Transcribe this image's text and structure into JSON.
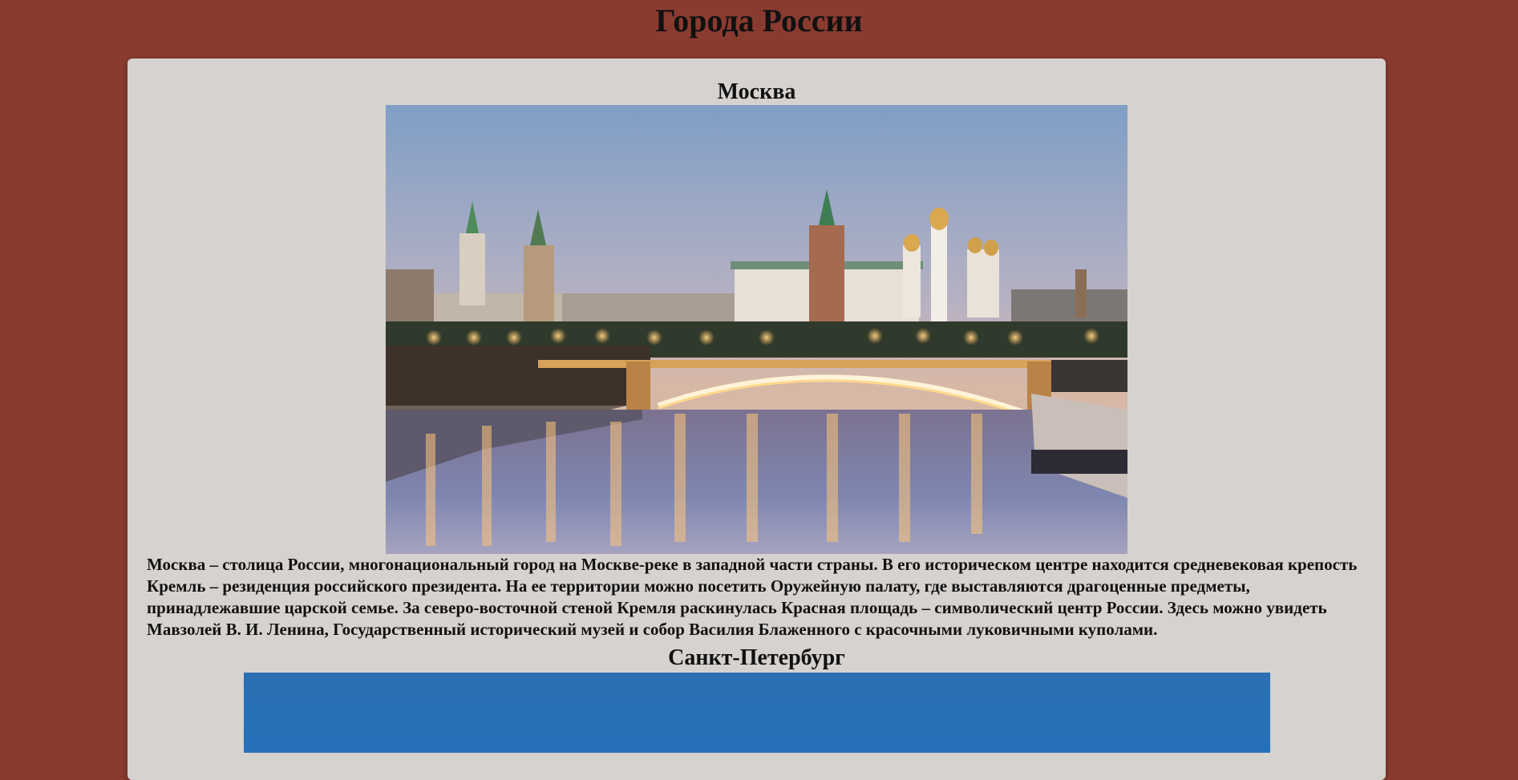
{
  "page": {
    "title": "Города России"
  },
  "cities": [
    {
      "name": "Москва",
      "image_icon": "moscow-kremlin-photo",
      "description": "Москва – столица России, многонациональный город на Москве-реке в западной части страны. В его историческом центре находится средневековая крепость Кремль – резиденция российского президента. На ее территории можно посетить Оружейную палату, где выставляются драгоценные предметы, принадлежавшие царской семье. За северо-восточной стеной Кремля раскинулась Красная площадь – символический центр России. Здесь можно увидеть Мавзолей В. И. Ленина, Государственный исторический музей и собор Василия Блаженного с красочными луковичными куполами."
    },
    {
      "name": "Санкт-Петербург",
      "image_icon": "saint-petersburg-photo"
    }
  ],
  "colors": {
    "background": "#8a3b2f",
    "card": "#d6d2cf",
    "text": "#111111"
  }
}
